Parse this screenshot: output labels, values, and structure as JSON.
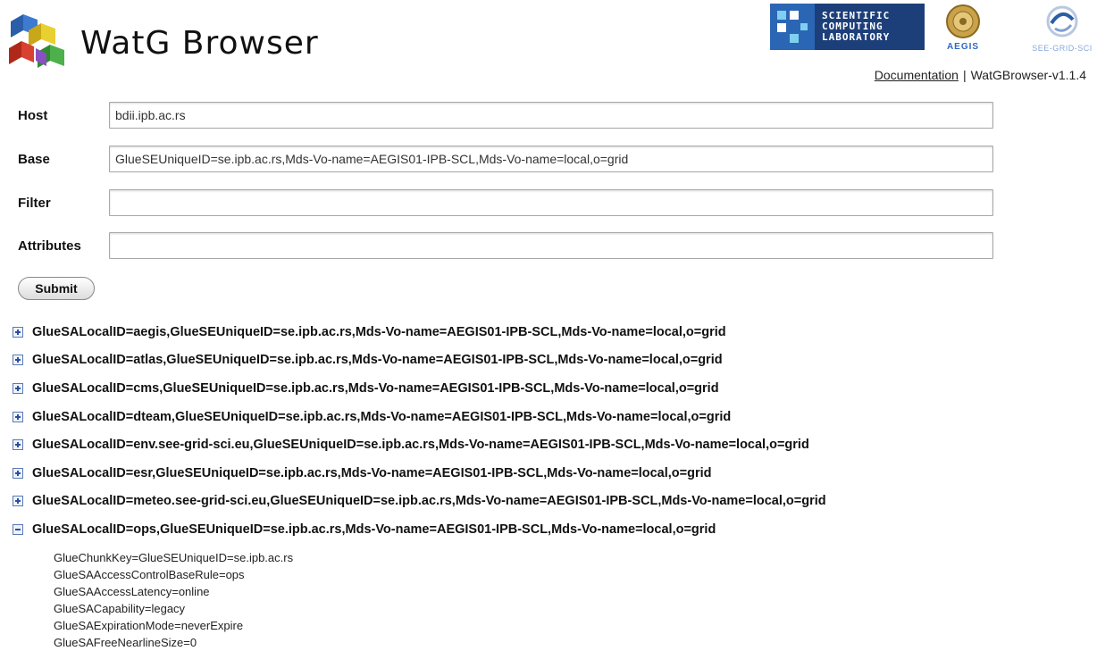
{
  "header": {
    "title": "WatG Browser",
    "logos": {
      "scientific_computing_lab": [
        "SCIENTIFIC",
        "COMPUTING",
        "LABORATORY"
      ],
      "aegis": "AEGIS",
      "see_grid_sci": "SEE-GRID-SCI"
    },
    "documentation_link": "Documentation",
    "separator": "|",
    "version": "WatGBrowser-v1.1.4"
  },
  "form": {
    "host": {
      "label": "Host",
      "value": "bdii.ipb.ac.rs"
    },
    "base": {
      "label": "Base",
      "value": "GlueSEUniqueID=se.ipb.ac.rs,Mds-Vo-name=AEGIS01-IPB-SCL,Mds-Vo-name=local,o=grid"
    },
    "filter": {
      "label": "Filter",
      "value": ""
    },
    "attributes": {
      "label": "Attributes",
      "value": ""
    },
    "submit_label": "Submit"
  },
  "entries": [
    {
      "dn": "GlueSALocalID=aegis,GlueSEUniqueID=se.ipb.ac.rs,Mds-Vo-name=AEGIS01-IPB-SCL,Mds-Vo-name=local,o=grid",
      "expanded": false
    },
    {
      "dn": "GlueSALocalID=atlas,GlueSEUniqueID=se.ipb.ac.rs,Mds-Vo-name=AEGIS01-IPB-SCL,Mds-Vo-name=local,o=grid",
      "expanded": false
    },
    {
      "dn": "GlueSALocalID=cms,GlueSEUniqueID=se.ipb.ac.rs,Mds-Vo-name=AEGIS01-IPB-SCL,Mds-Vo-name=local,o=grid",
      "expanded": false
    },
    {
      "dn": "GlueSALocalID=dteam,GlueSEUniqueID=se.ipb.ac.rs,Mds-Vo-name=AEGIS01-IPB-SCL,Mds-Vo-name=local,o=grid",
      "expanded": false
    },
    {
      "dn": "GlueSALocalID=env.see-grid-sci.eu,GlueSEUniqueID=se.ipb.ac.rs,Mds-Vo-name=AEGIS01-IPB-SCL,Mds-Vo-name=local,o=grid",
      "expanded": false
    },
    {
      "dn": "GlueSALocalID=esr,GlueSEUniqueID=se.ipb.ac.rs,Mds-Vo-name=AEGIS01-IPB-SCL,Mds-Vo-name=local,o=grid",
      "expanded": false
    },
    {
      "dn": "GlueSALocalID=meteo.see-grid-sci.eu,GlueSEUniqueID=se.ipb.ac.rs,Mds-Vo-name=AEGIS01-IPB-SCL,Mds-Vo-name=local,o=grid",
      "expanded": false
    },
    {
      "dn": "GlueSALocalID=ops,GlueSEUniqueID=se.ipb.ac.rs,Mds-Vo-name=AEGIS01-IPB-SCL,Mds-Vo-name=local,o=grid",
      "expanded": true
    }
  ],
  "expanded_attributes": [
    "GlueChunkKey=GlueSEUniqueID=se.ipb.ac.rs",
    "GlueSAAccessControlBaseRule=ops",
    "GlueSAAccessLatency=online",
    "GlueSACapability=legacy",
    "GlueSAExpirationMode=neverExpire",
    "GlueSAFreeNearlineSize=0"
  ],
  "colors": {
    "scl_bg": "#1c3f7a",
    "toggle_border": "#5a7ab8",
    "aegis_text": "#2f68c5"
  }
}
